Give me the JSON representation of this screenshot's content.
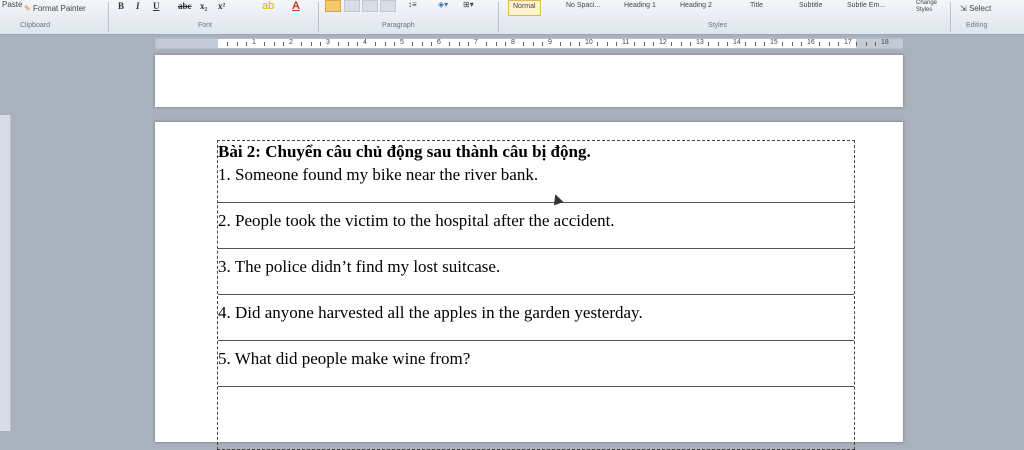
{
  "ribbon": {
    "paste_label": "Paste",
    "format_painter_label": "Format Painter",
    "clipboard_group": "Clipboard",
    "font_group": "Font",
    "paragraph_group": "Paragraph",
    "styles_group": "Styles",
    "editing_group": "Editing",
    "change_styles_label": "Change Styles",
    "select_label": "Select",
    "styles": [
      "Normal",
      "No Spaci...",
      "Heading 1",
      "Heading 2",
      "Title",
      "Subtitle",
      "Subtle Em..."
    ]
  },
  "ruler": {
    "numbers": [
      "1",
      "2",
      "3",
      "4",
      "5",
      "6",
      "7",
      "8",
      "9",
      "10",
      "11",
      "12",
      "13",
      "14",
      "15",
      "16",
      "17",
      "18"
    ]
  },
  "document": {
    "title": "Bài 2: Chuyển câu chủ động sau thành câu bị động.",
    "questions": [
      "1. Someone found my bike near the river bank.",
      "2. People took the victim to the hospital after the accident.",
      "3. The police didn’t find my lost suitcase.",
      "4. Did anyone harvested all the apples in the garden yesterday.",
      "5. What did people make wine from?"
    ]
  }
}
